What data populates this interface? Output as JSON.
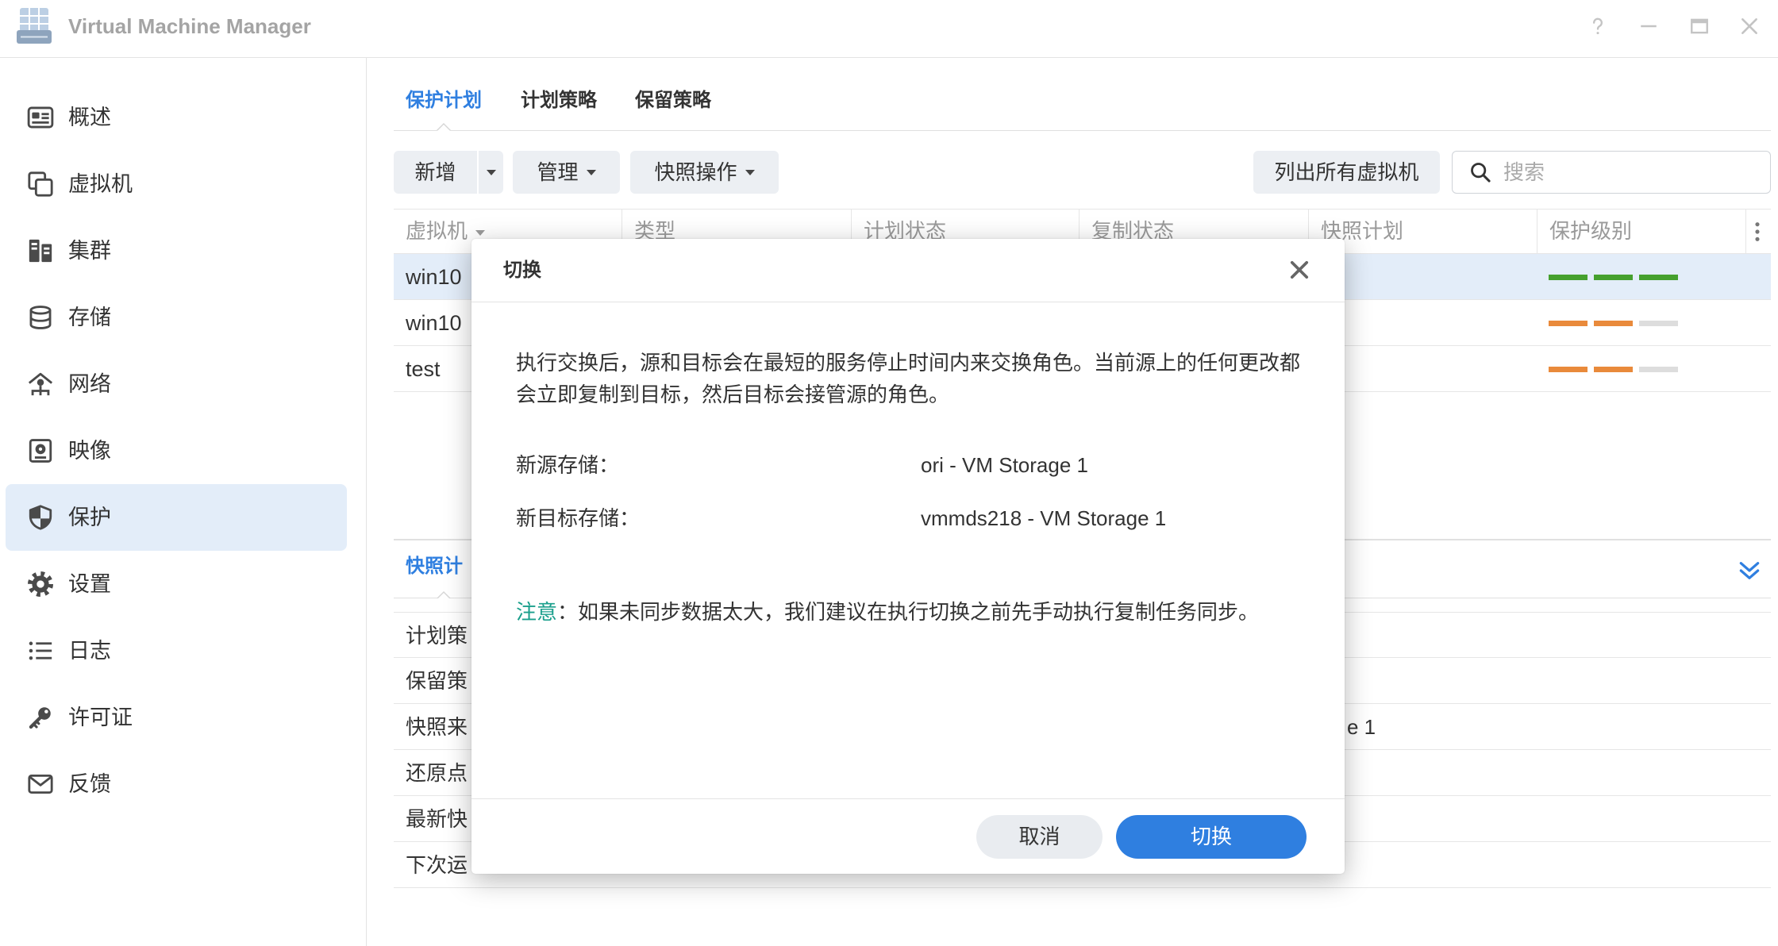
{
  "window": {
    "title": "Virtual Machine Manager",
    "app_icon": "vmm-app-icon",
    "controls": [
      "help-icon",
      "minimize-icon",
      "maximize-icon",
      "close-icon"
    ]
  },
  "sidebar": {
    "selected_index": 6,
    "items": [
      {
        "label": "概述",
        "icon": "overview-icon"
      },
      {
        "label": "虚拟机",
        "icon": "vm-icon"
      },
      {
        "label": "集群",
        "icon": "cluster-icon"
      },
      {
        "label": "存储",
        "icon": "storage-icon"
      },
      {
        "label": "网络",
        "icon": "network-icon"
      },
      {
        "label": "映像",
        "icon": "image-icon"
      },
      {
        "label": "保护",
        "icon": "shield-icon"
      },
      {
        "label": "设置",
        "icon": "gear-icon"
      },
      {
        "label": "日志",
        "icon": "list-icon"
      },
      {
        "label": "许可证",
        "icon": "key-icon"
      },
      {
        "label": "反馈",
        "icon": "envelope-icon"
      }
    ]
  },
  "tabs": [
    {
      "label": "保护计划",
      "active": true
    },
    {
      "label": "计划策略",
      "active": false
    },
    {
      "label": "保留策略",
      "active": false
    }
  ],
  "toolbar": {
    "add_label": "新增",
    "manage_label": "管理",
    "snapshot_ops_label": "快照操作",
    "list_all_label": "列出所有虚拟机",
    "search_placeholder": "搜索"
  },
  "table": {
    "columns": [
      "虚拟机",
      "类型",
      "计划状态",
      "复制状态",
      "快照计划",
      "保护级别"
    ],
    "sort_column": 0,
    "protection_level_max": 3,
    "rows": [
      {
        "vm": "win10",
        "selected": true,
        "protection_level": 3
      },
      {
        "vm": "win10",
        "selected": false,
        "protection_level": 2
      },
      {
        "vm": "test",
        "selected": false,
        "protection_level": 2
      }
    ]
  },
  "detail_panel": {
    "tab_label": "快照计",
    "rows": [
      {
        "label": "计划策"
      },
      {
        "label": "保留策"
      },
      {
        "label": "快照来",
        "value": "e 1"
      },
      {
        "label": "还原点"
      },
      {
        "label": "最新快"
      },
      {
        "label": "下次运"
      }
    ]
  },
  "dialog": {
    "title": "切换",
    "description": "执行交换后，源和目标会在最短的服务停止时间内来交换角色。当前源上的任何更改都会立即复制到目标，然后目标会接管源的角色。",
    "new_source_label": "新源存储：",
    "new_source_value": "ori - VM Storage 1",
    "new_target_label": "新目标存储：",
    "new_target_value": "vmmds218 - VM Storage 1",
    "note_label": "注意",
    "note_text": "：如果未同步数据太大，我们建议在执行切换之前先手动执行复制任务同步。",
    "cancel_label": "取消",
    "confirm_label": "切换"
  },
  "colors": {
    "accent": "#2f7fe0",
    "selection": "#e3edf9",
    "note": "#1a9f8c",
    "level_full": "#45a02e",
    "level_partial": "#e98a3b",
    "level_empty": "#dddddd"
  }
}
